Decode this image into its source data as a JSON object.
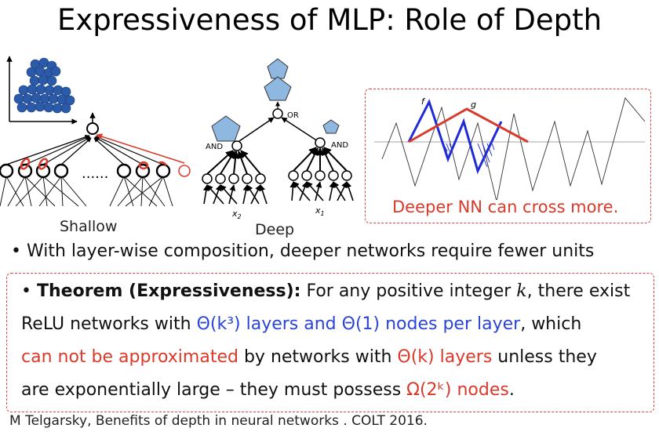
{
  "title": "Expressiveness of MLP: Role of Depth",
  "figure": {
    "shallow_label": "Shallow",
    "shallow_dots": "......",
    "deep_label": "Deep",
    "deep_or": "OR",
    "deep_and_left": "AND",
    "deep_and_right": "AND",
    "deep_x2": "x",
    "deep_x2_sub": "2",
    "deep_x1": "x",
    "deep_x1_sub": "1",
    "curve_f": "f",
    "curve_g": "g",
    "caption": "Deeper NN can cross more."
  },
  "bullet1": "With layer-wise composition, deeper networks require fewer units",
  "theorem": {
    "bullet": "•",
    "heading": "Theorem (Expressiveness):",
    "line1_text": " For any positive integer ",
    "line1_var": "k",
    "line1_end": ", there exist",
    "line2_a": "ReLU networks with ",
    "line2_b": "Θ(k³) layers and Θ(1) nodes per layer",
    "line2_c": ", which",
    "line3_a": "can not be approximated",
    "line3_b": " by networks with ",
    "line3_c": "Θ(k) layers",
    "line3_d": " unless they",
    "line4_a": "are exponentially large – they must possess ",
    "line4_b": "Ω(2ᵏ) nodes",
    "line4_c": "."
  },
  "citation": "M Telgarsky, Benefits of depth in neural networks . COLT 2016.",
  "colors": {
    "red": "#d93a2b",
    "blue": "#2a44d8",
    "shape_fill": "#8fb8e0",
    "ball": "#2a5aa8"
  }
}
